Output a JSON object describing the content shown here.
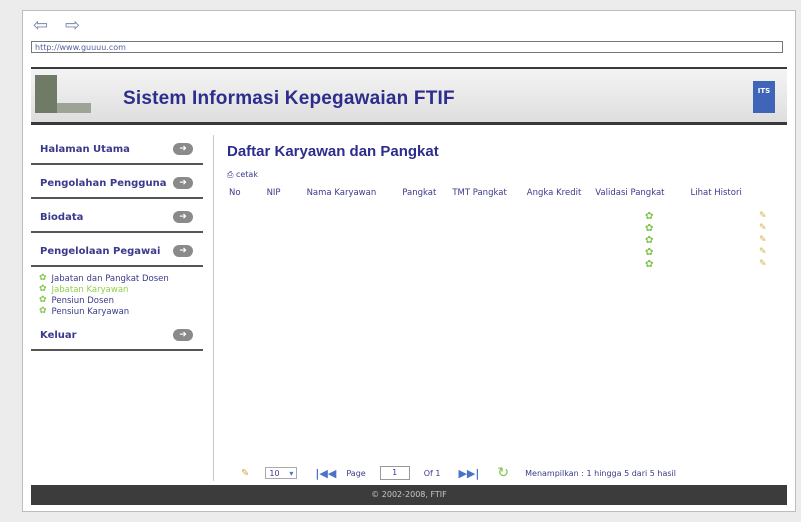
{
  "browser": {
    "back_icon": "back-arrow-icon",
    "forward_icon": "forward-arrow-icon",
    "url": "http://www.guuuu.com"
  },
  "header": {
    "title": "Sistem Informasi Kepegawaian FTIF",
    "logo_right": "ITS"
  },
  "sidebar": {
    "items": [
      {
        "label": "Halaman Utama"
      },
      {
        "label": "Pengolahan Pengguna"
      },
      {
        "label": "Biodata"
      },
      {
        "label": "Pengelolaan Pegawai"
      }
    ],
    "subitems": [
      {
        "label": "Jabatan dan Pangkat Dosen",
        "active": false
      },
      {
        "label": "Jabatan Karyawan",
        "active": true
      },
      {
        "label": "Pensiun Dosen",
        "active": false
      },
      {
        "label": "Pensiun Karyawan",
        "active": false
      }
    ],
    "logout": {
      "label": "Keluar"
    }
  },
  "main": {
    "title": "Daftar Karyawan dan Pangkat",
    "print_label": "cetak",
    "columns": [
      "No",
      "NIP",
      "Nama Karyawan",
      "Pangkat",
      "TMT Pangkat",
      "Angka Kredit",
      "Validasi Pangkat",
      "Lihat Histori"
    ],
    "rows": [
      {},
      {},
      {},
      {},
      {}
    ]
  },
  "pager": {
    "page_size": "10",
    "page_label": "Page",
    "page_value": "1",
    "of_label": "Of 1",
    "status": "Menampilkan : 1 hingga 5 dari 5 hasil"
  },
  "footer": {
    "text": "© 2002-2008, FTIF"
  }
}
